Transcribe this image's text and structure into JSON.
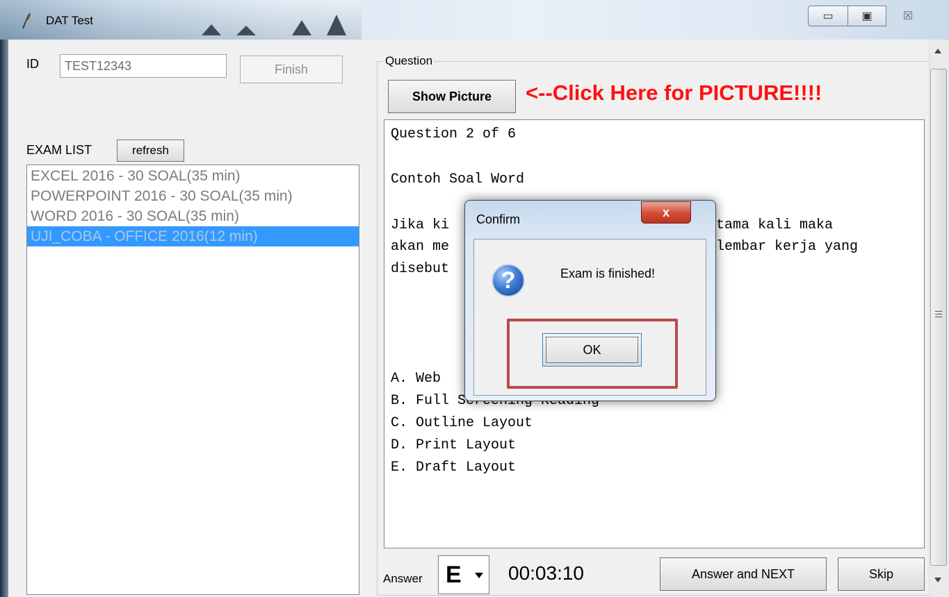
{
  "window": {
    "title": "DAT Test",
    "minimize_glyph": "▭",
    "maximize_glyph": "▣",
    "close_glyph": "☒"
  },
  "login": {
    "id_label": "ID",
    "id_value": "TEST12343",
    "finish_label": "Finish"
  },
  "exam_list": {
    "label": "EXAM LIST",
    "refresh_label": "refresh",
    "items": [
      {
        "label": "EXCEL 2016 - 30 SOAL(35 min)"
      },
      {
        "label": "POWERPOINT 2016 - 30 SOAL(35 min)"
      },
      {
        "label": "WORD 2016 - 30 SOAL(35 min)"
      },
      {
        "label": "UJI_COBA - OFFICE 2016(12 min)",
        "selected": true
      }
    ]
  },
  "question": {
    "group_label": "Question",
    "show_picture_label": "Show Picture",
    "picture_hint": "<--Click Here for PICTURE!!!!",
    "counter": "Question 2 of 6",
    "heading": "Contoh Soal Word",
    "body_line1_left": "Jika ki",
    "body_line1_right": "tama kali maka",
    "body_line2_left": "akan me",
    "body_line2_right": "lembar kerja yang",
    "body_line3_left": "disebut",
    "options": [
      "A. Web",
      "B. Full Screening Reading",
      "C. Outline Layout",
      "D. Print Layout",
      "E. Draft Layout"
    ]
  },
  "answer": {
    "label": "Answer",
    "selected": "E",
    "timer": "00:03:10",
    "answer_next_label": "Answer and NEXT",
    "skip_label": "Skip"
  },
  "dialog": {
    "title": "Confirm",
    "close_glyph": "x",
    "icon_glyph": "?",
    "message": "Exam is finished!",
    "ok_label": "OK"
  },
  "colors": {
    "selection": "#3399ff",
    "hint_red": "#ff1111",
    "highlight_box": "#b84a4a"
  }
}
